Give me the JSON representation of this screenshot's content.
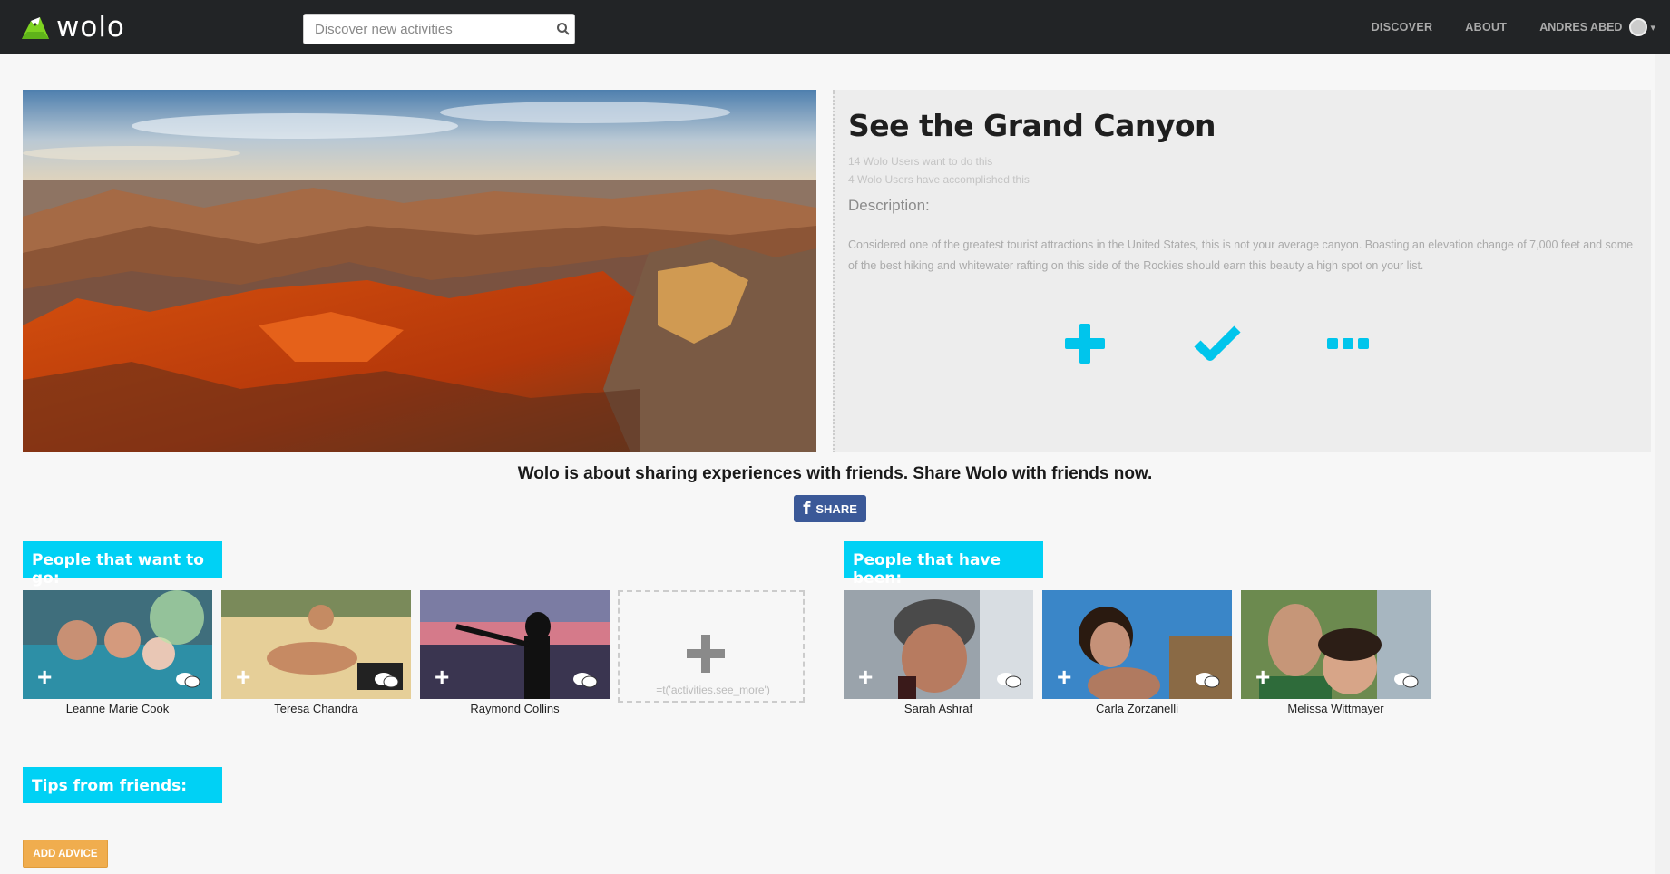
{
  "app": {
    "logo_text": "wolo"
  },
  "nav": {
    "search_placeholder": "Discover new activities",
    "discover": "DISCOVER",
    "about": "ABOUT",
    "user": "ANDRES ABED"
  },
  "activity": {
    "title": "See the Grand Canyon",
    "want_count": "14 Wolo Users want to do this",
    "done_count": "4 Wolo Users have accomplished this",
    "desc_label": "Description:",
    "description": "Considered one of the greatest tourist attractions in the United States, this is not your average canyon. Boasting an elevation change of 7,000 feet and some of the best hiking and whitewater rafting on this side of the Rockies should earn this beauty a high spot on your list."
  },
  "share": {
    "text": "Wolo is about sharing experiences with friends. Share Wolo with friends now.",
    "button": "SHARE"
  },
  "want_section": {
    "title": "People that want to go:",
    "people": [
      "Leanne Marie Cook",
      "Teresa Chandra",
      "Raymond Collins"
    ],
    "see_more": "=t('activities.see_more')"
  },
  "been_section": {
    "title": "People that have been:",
    "people": [
      "Sarah Ashraf",
      "Carla Zorzanelli",
      "Melissa Wittmayer"
    ]
  },
  "tips": {
    "title": "Tips from friends:",
    "add_button": "ADD ADVICE"
  },
  "colors": {
    "accent": "#00d1f5",
    "nav_bg": "#222426",
    "advice_btn": "#f0ad4e",
    "facebook": "#3b5998"
  }
}
